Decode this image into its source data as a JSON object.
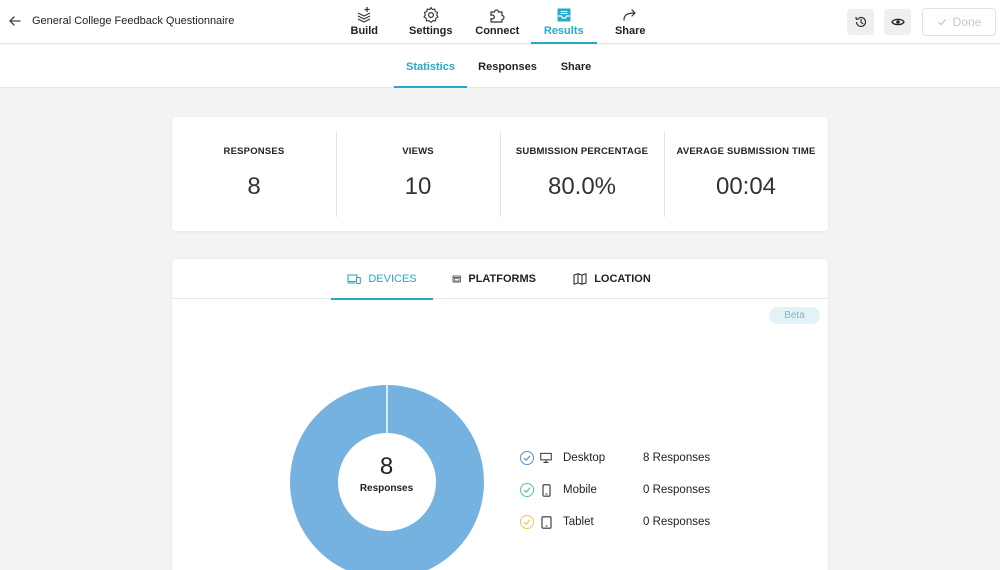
{
  "header": {
    "title": "General College Feedback Questionnaire",
    "tabs": [
      {
        "label": "Build",
        "icon": "build-icon"
      },
      {
        "label": "Settings",
        "icon": "gear-icon"
      },
      {
        "label": "Connect",
        "icon": "puzzle-icon"
      },
      {
        "label": "Results",
        "icon": "inbox-icon",
        "active": true
      },
      {
        "label": "Share",
        "icon": "share-arrow-icon"
      }
    ],
    "done_label": "Done"
  },
  "subtabs": [
    {
      "label": "Statistics",
      "active": true
    },
    {
      "label": "Responses"
    },
    {
      "label": "Share"
    }
  ],
  "stats": [
    {
      "label": "RESPONSES",
      "value": "8"
    },
    {
      "label": "VIEWS",
      "value": "10"
    },
    {
      "label": "SUBMISSION PERCENTAGE",
      "value": "80.0%"
    },
    {
      "label": "AVERAGE SUBMISSION TIME",
      "value": "00:04"
    }
  ],
  "device_tabs": [
    {
      "label": "DEVICES",
      "icon": "devices-icon",
      "active": true
    },
    {
      "label": "PLATFORMS",
      "icon": "platforms-icon"
    },
    {
      "label": "LOCATION",
      "icon": "map-icon"
    }
  ],
  "beta_label": "Beta",
  "donut": {
    "count": "8",
    "label": "Responses"
  },
  "legend": [
    {
      "name": "Desktop",
      "value": "8 Responses",
      "count": 8,
      "color": "#4f95d6"
    },
    {
      "name": "Mobile",
      "value": "0 Responses",
      "count": 0,
      "color": "#5cc48a"
    },
    {
      "name": "Tablet",
      "value": "0 Responses",
      "count": 0,
      "color": "#f0c35a"
    }
  ],
  "colors": {
    "accent": "#29a9c9",
    "donut_fill": "#76b2e0"
  }
}
